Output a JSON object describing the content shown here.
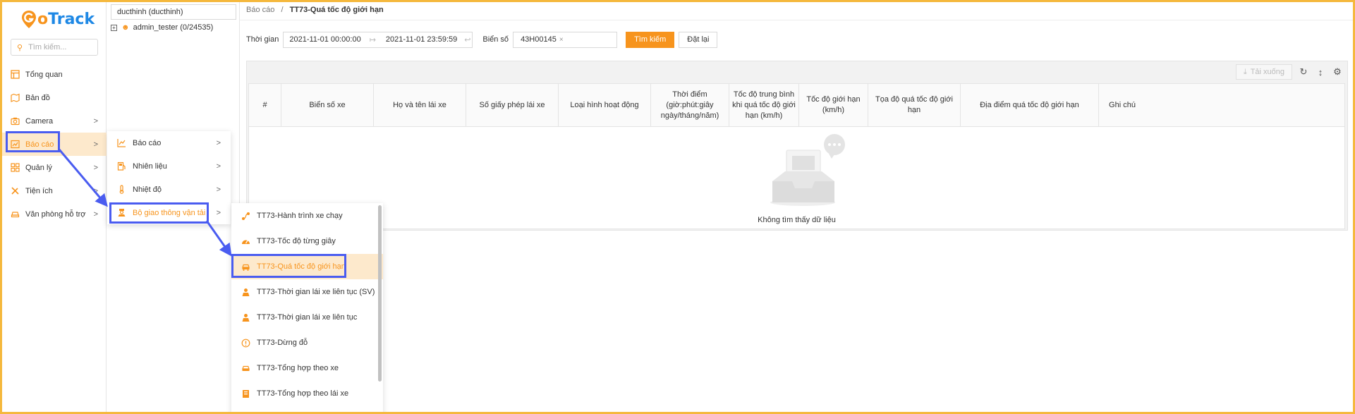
{
  "brand": {
    "name_g": "G",
    "name_o": "o",
    "name_rest": "Track",
    "accent": "#f7941d",
    "blue": "#1e88e5"
  },
  "sidebar": {
    "search_placeholder": "Tìm kiếm...",
    "items": [
      {
        "label": "Tổng quan",
        "icon": "dashboard-icon",
        "chevron": ""
      },
      {
        "label": "Bản đồ",
        "icon": "map-icon",
        "chevron": ""
      },
      {
        "label": "Camera",
        "icon": "camera-icon",
        "chevron": ">"
      },
      {
        "label": "Báo cáo",
        "icon": "report-icon",
        "chevron": ">"
      },
      {
        "label": "Quản lý",
        "icon": "grid-icon",
        "chevron": ">"
      },
      {
        "label": "Tiện ích",
        "icon": "tools-icon",
        "chevron": ">"
      },
      {
        "label": "Văn phòng hỗ trợ",
        "icon": "car-icon",
        "chevron": ">"
      }
    ]
  },
  "tree": {
    "account": "ducthinh (ducthinh)",
    "node_label": "admin_tester (0/24535)"
  },
  "breadcrumb": {
    "root": "Báo cáo",
    "sep": "/",
    "current": "TT73-Quá tốc độ giới hạn"
  },
  "filters": {
    "time_label": "Thời gian",
    "time_from": "2021-11-01 00:00:00",
    "time_to": "2021-11-01 23:59:59",
    "plate_label": "Biển số",
    "plate_value": "43H00145",
    "search_button": "Tìm kiếm",
    "reset_button": "Đặt lại"
  },
  "toolbar": {
    "download": "Tải xuống"
  },
  "table": {
    "columns": [
      "#",
      "Biển số xe",
      "Họ và tên lái xe",
      "Số giấy phép lái xe",
      "Loại hình hoạt động",
      "Thời điểm (giờ:phút:giây ngày/tháng/năm)",
      "Tốc độ trung bình khi quá tốc độ giới hạn (km/h)",
      "Tốc độ giới hạn (km/h)",
      "Tọa độ quá tốc độ giới hạn",
      "Địa điểm quá tốc độ giới hạn",
      "Ghi chú"
    ],
    "empty_text": "Không tìm thấy dữ liệu"
  },
  "menu1": {
    "items": [
      {
        "label": "Báo cáo",
        "icon": "line-chart-icon",
        "chevron": ">"
      },
      {
        "label": "Nhiên liệu",
        "icon": "fuel-icon",
        "chevron": ">"
      },
      {
        "label": "Nhiệt độ",
        "icon": "thermometer-icon",
        "chevron": ">"
      },
      {
        "label": "Bộ giao thông vận tải",
        "icon": "police-icon",
        "chevron": ">"
      }
    ]
  },
  "menu2": {
    "items": [
      {
        "label": "TT73-Hành trình xe chạy",
        "icon": "route-icon"
      },
      {
        "label": "TT73-Tốc độ từng giây",
        "icon": "speedometer-icon"
      },
      {
        "label": "TT73-Quá tốc độ giới hạn",
        "icon": "car-icon"
      },
      {
        "label": "TT73-Thời gian lái xe liên tục (SV)",
        "icon": "driver-icon"
      },
      {
        "label": "TT73-Thời gian lái xe liên tục",
        "icon": "driver-icon"
      },
      {
        "label": "TT73-Dừng đỗ",
        "icon": "alert-circle-icon"
      },
      {
        "label": "TT73-Tổng hợp theo xe",
        "icon": "car-icon"
      },
      {
        "label": "TT73-Tổng hợp theo lái xe",
        "icon": "document-icon"
      }
    ]
  }
}
